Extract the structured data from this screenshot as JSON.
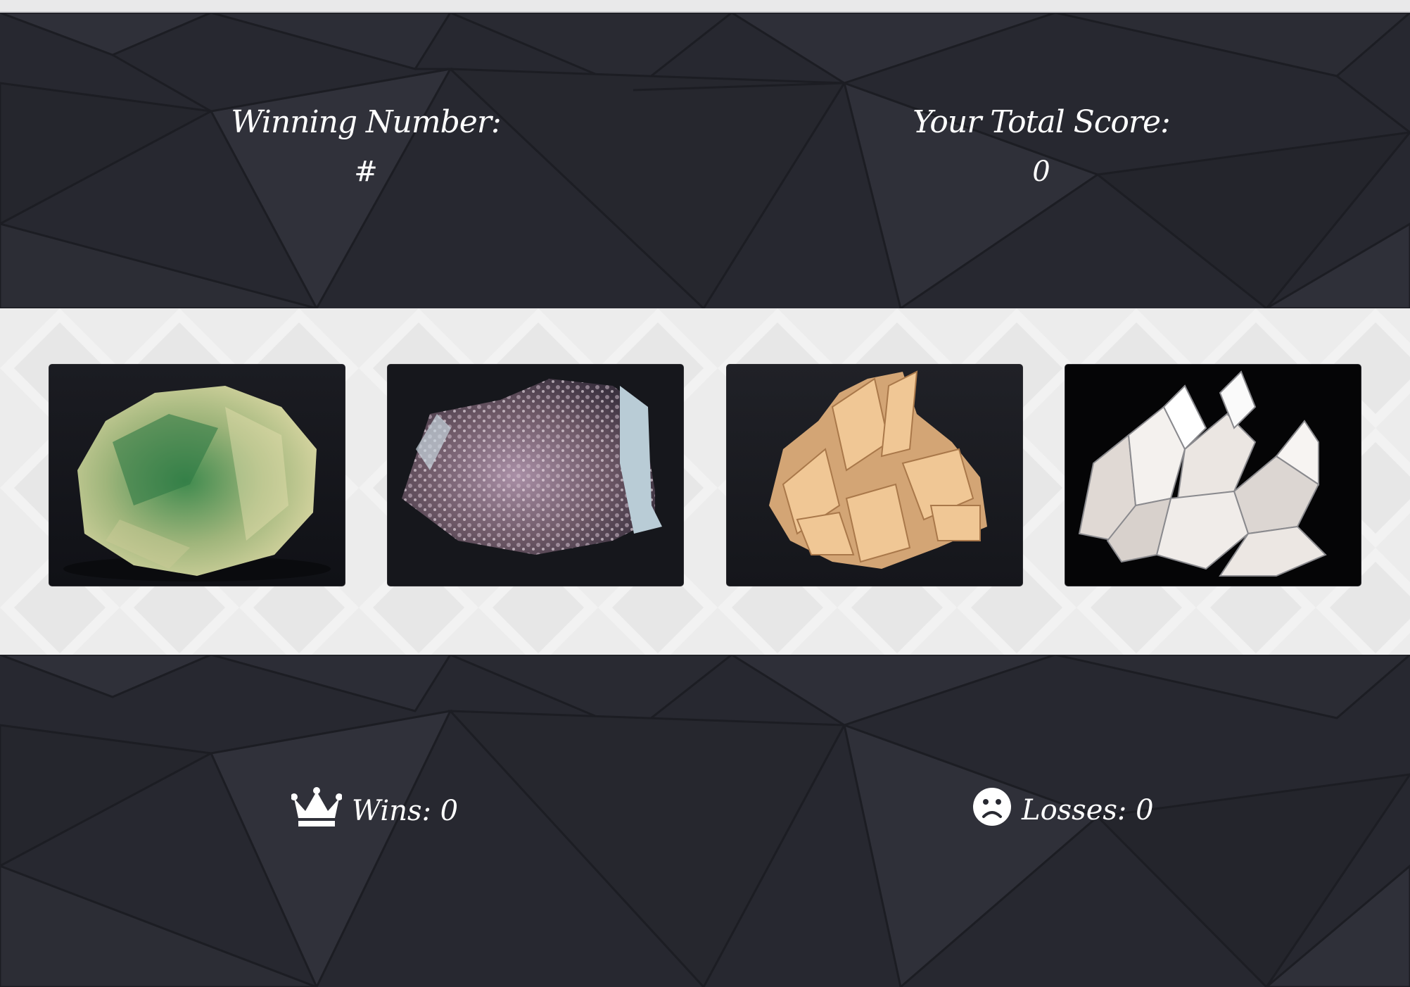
{
  "scoreboard": {
    "winning_label": "Winning Number:",
    "winning_value": "#",
    "total_label": "Your Total Score:",
    "total_value": "0"
  },
  "crystals": [
    {
      "name": "green-fluorite-crystal",
      "icon": "green-crystal"
    },
    {
      "name": "amethyst-geode-crystal",
      "icon": "purple-crystal"
    },
    {
      "name": "desert-rose-crystal",
      "icon": "orange-crystal"
    },
    {
      "name": "clear-quartz-crystal",
      "icon": "clear-crystal"
    }
  ],
  "stats": {
    "wins_text": "Wins: 0",
    "losses_text": "Losses: 0",
    "wins_icon": "crown-icon",
    "losses_icon": "sad-face-icon"
  },
  "colors": {
    "dark_background": "#272830",
    "light_band": "#ececec",
    "text": "#ffffff"
  }
}
